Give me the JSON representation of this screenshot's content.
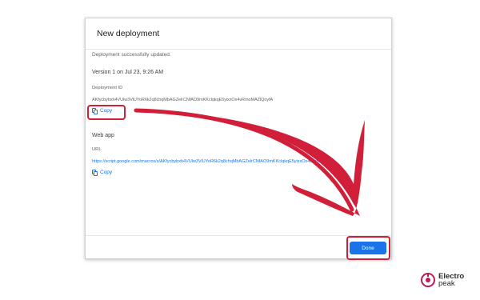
{
  "dialog": {
    "title": "New deployment",
    "status": "Deployment successfully updated.",
    "version": "Version 1 on Jul 23, 9:26 AM",
    "deployment_id_label": "Deployment ID",
    "deployment_id_value": "AKfycbybxh4VUlw3ViUYoR6k2q8chqMbAGZelrCNfAO9mKKclqkqE5yixxOx4vRmoMAZlQoyfA",
    "copy_label": "Copy",
    "web_app_title": "Web app",
    "url_label": "URL",
    "url_value": "https://script.google.com/macros/s/AKfycbybxh4VUlw3ViUYoR6k2q8chqMbAGZelrCNfAO9mKKclqkqE5yixxOx4vRmoM...",
    "url_copy_label": "Copy",
    "done_label": "Done"
  },
  "logo": {
    "line1": "Electro",
    "line2": "peak",
    "accent": "#c2185b"
  },
  "colors": {
    "highlight": "#d11f3a",
    "arrow": "#d11f3a",
    "link": "#1a73e8"
  }
}
